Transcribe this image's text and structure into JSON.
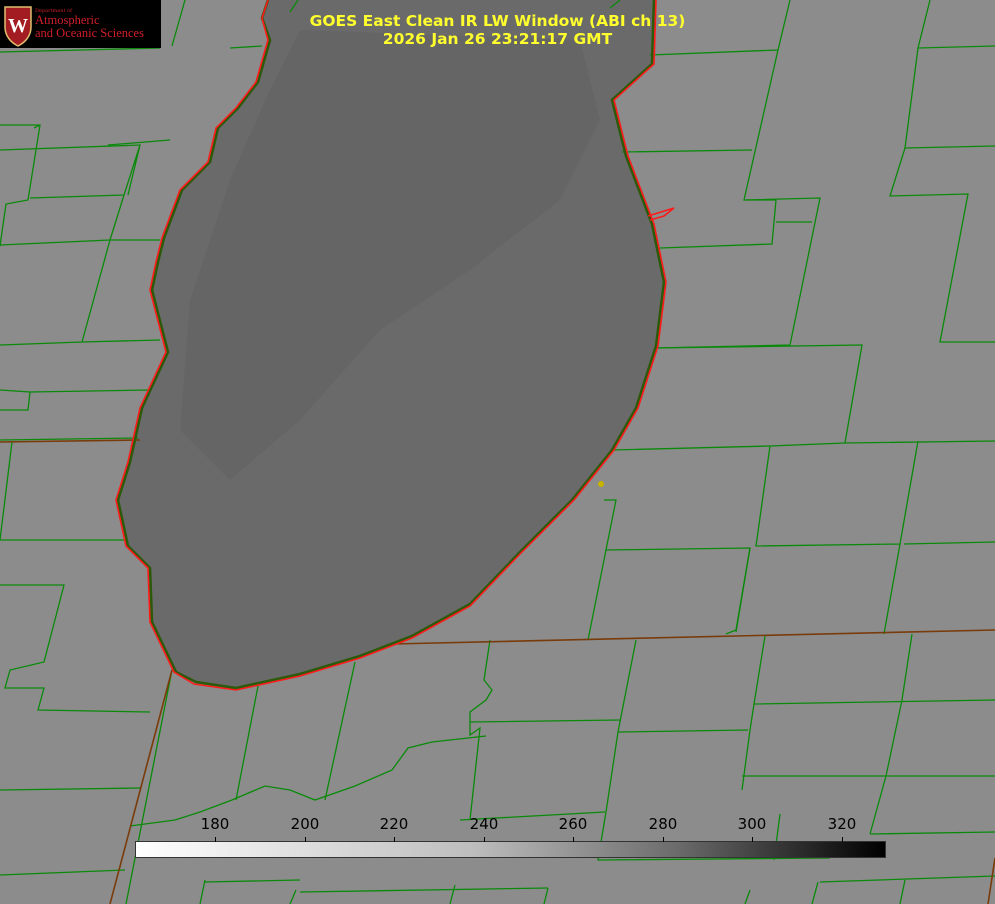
{
  "title": {
    "line1": "GOES East Clean IR LW Window (ABI ch 13)",
    "line2": "2026 Jan 26 23:21:17 GMT"
  },
  "logo": {
    "dept": "Department of",
    "line1": "Atmospheric",
    "line2": "and Oceanic Sciences",
    "crest_letter": "W"
  },
  "colorbar": {
    "ticks": [
      "180",
      "200",
      "220",
      "240",
      "260",
      "280",
      "300",
      "320"
    ]
  },
  "colors": {
    "land": "#8c8c8c",
    "lake": "#6a6a6a",
    "county_lines": "#0a8a0a",
    "coastline": "#ff1a1a",
    "state_line": "#7a3b0a",
    "title": "#ffff2e",
    "marker": "#c8b400"
  },
  "map_features": [
    "county-boundaries",
    "lake-michigan-shoreline",
    "state-boundary",
    "location-marker"
  ]
}
